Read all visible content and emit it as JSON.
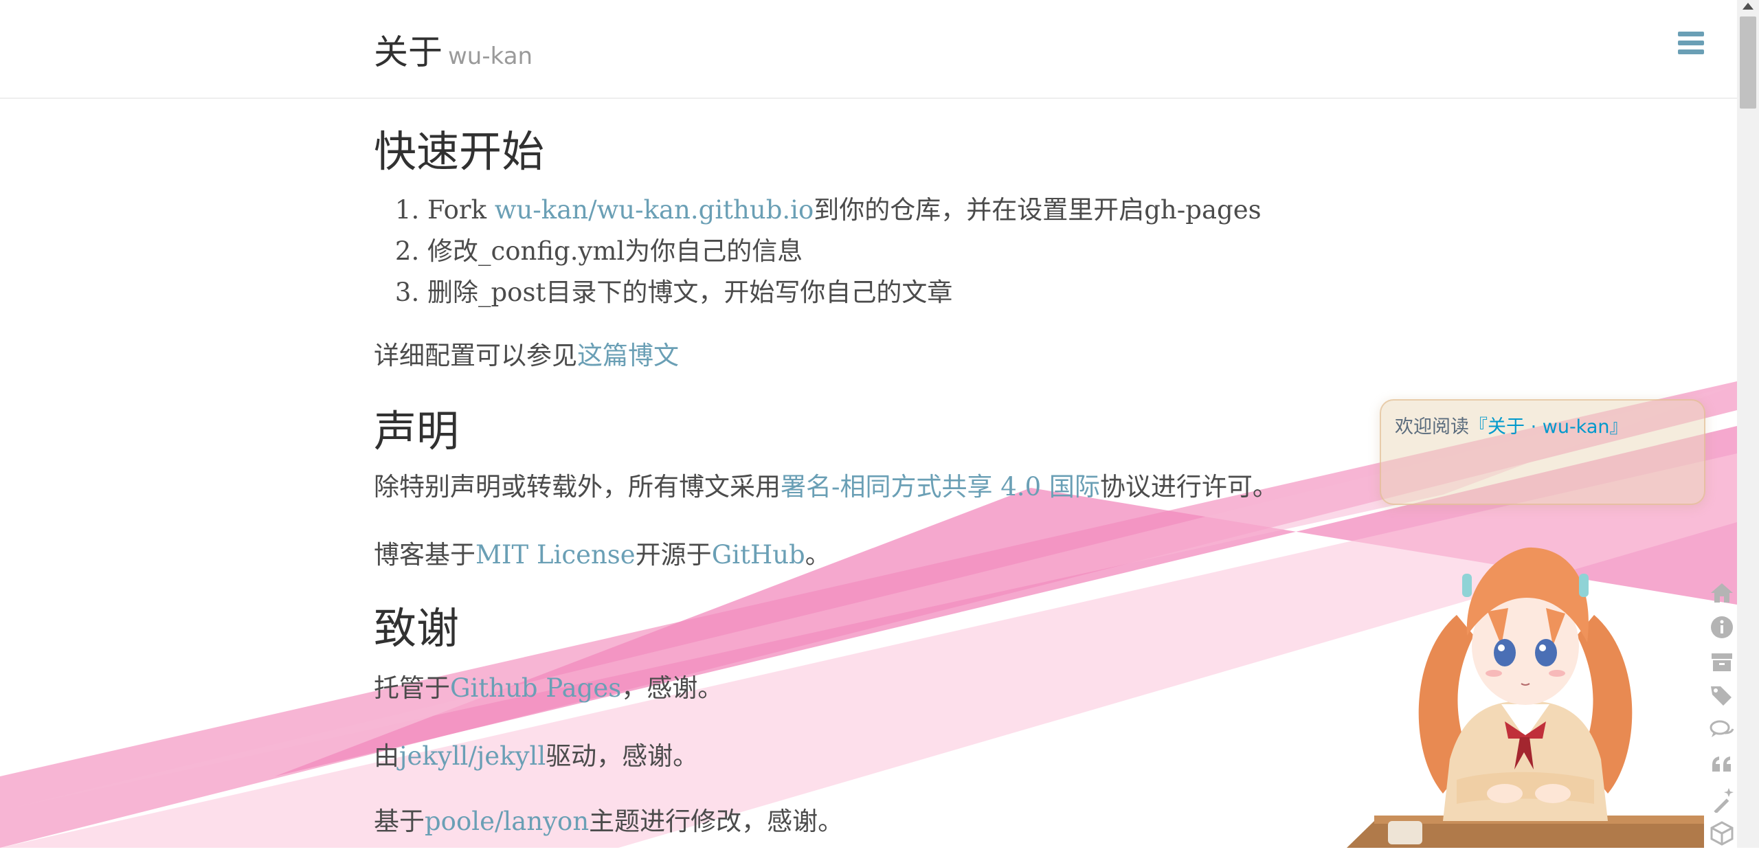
{
  "masthead": {
    "title": "关于",
    "subtitle": "wu-kan",
    "menu_icon": "hamburger-menu-icon"
  },
  "quick_start": {
    "heading": "快速开始",
    "steps": [
      {
        "pre": "Fork ",
        "link": "wu-kan/wu-kan.github.io",
        "post": "到你的仓库，并在设置里开启gh-pages"
      },
      {
        "text": "修改_config.yml为你自己的信息"
      },
      {
        "text": "删除_post目录下的博文，开始写你自己的文章"
      }
    ],
    "detail_pre": "详细配置可以参见",
    "detail_link": "这篇博文"
  },
  "declaration": {
    "heading": "声明",
    "p1_pre": "除特别声明或转载外，所有博文采用",
    "p1_link": "署名-相同方式共享 4.0 国际",
    "p1_post": "协议进行许可。",
    "p2_pre": "博客基于",
    "p2_link1": "MIT License",
    "p2_mid": "开源于",
    "p2_link2": "GitHub",
    "p2_post": "。"
  },
  "thanks": {
    "heading": "致谢",
    "p1_pre": "托管于",
    "p1_link": "Github Pages",
    "p1_post": "，感谢。",
    "p2_pre": "由",
    "p2_link": "jekyll/jekyll",
    "p2_post": "驱动，感谢。",
    "p3_pre": "基于",
    "p3_link": "poole/lanyon",
    "p3_post": "主题进行修改，感谢。"
  },
  "waifu": {
    "tip_pre": "欢迎阅读",
    "tip_link": "『关于 · wu-kan』",
    "tools": [
      "home-icon",
      "info-icon",
      "archive-icon",
      "tags-icon",
      "comments-icon",
      "quote-icon",
      "magic-wand-icon",
      "cube-icon"
    ]
  },
  "colors": {
    "link": "#6a9fb5",
    "heading": "#313131",
    "body_text": "#4b4b4b",
    "ribbon_pink": "#f28bbd",
    "tip_link": "#0099cc"
  }
}
